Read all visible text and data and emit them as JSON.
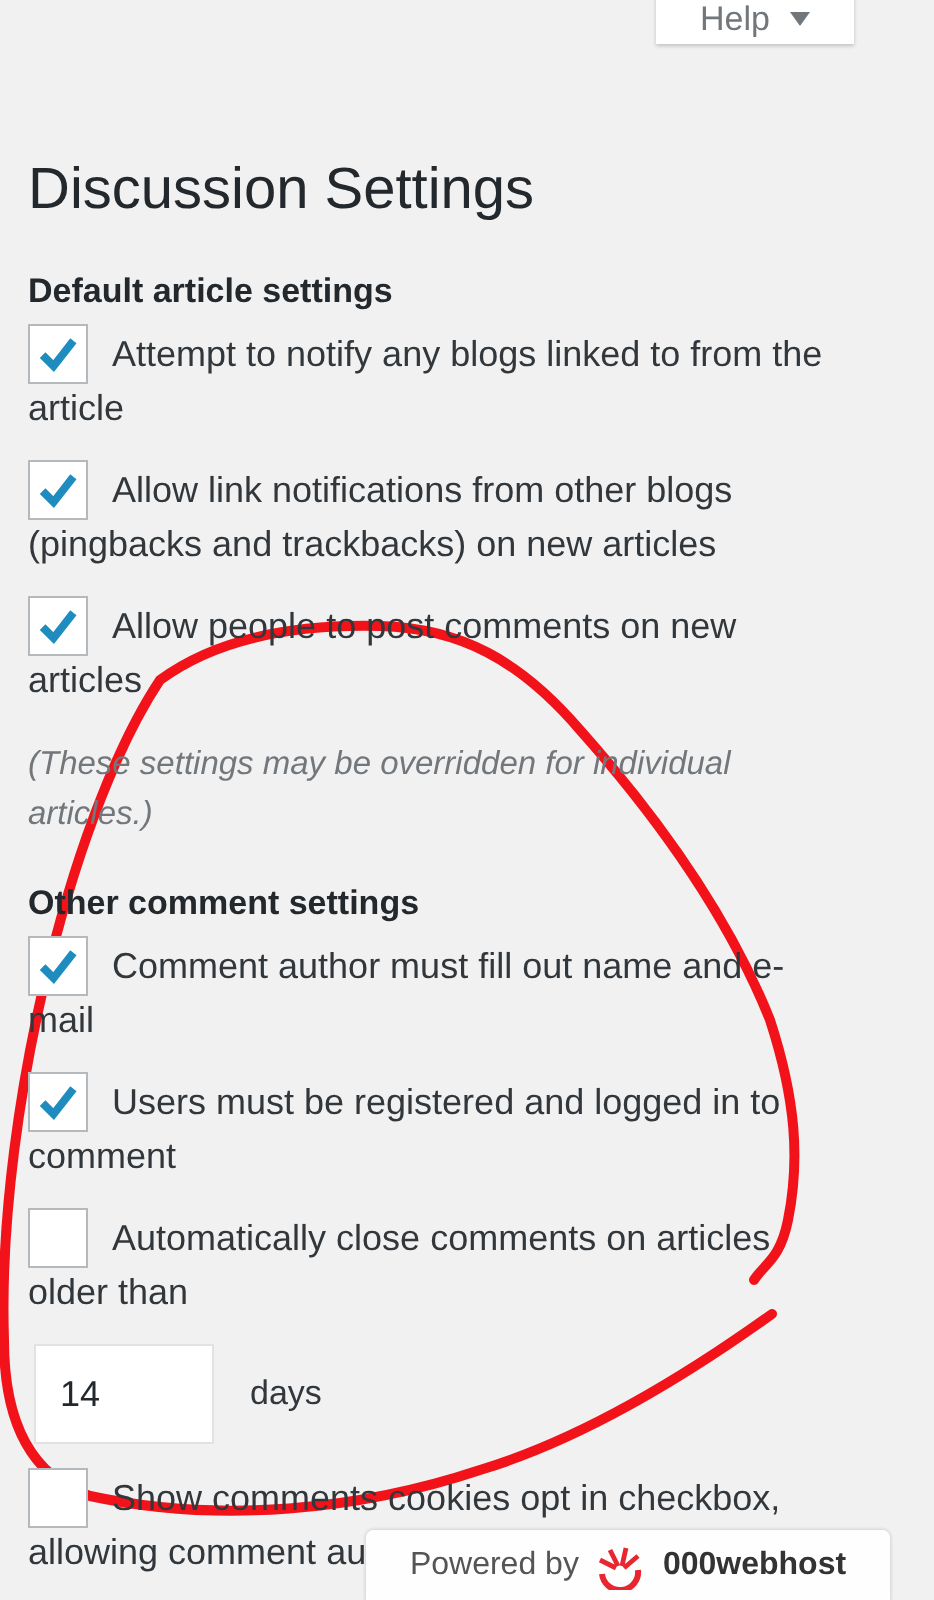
{
  "help_button": {
    "label": "Help"
  },
  "title": "Discussion Settings",
  "sections": [
    {
      "heading": "Default article settings",
      "items": [
        {
          "kind": "checkbox",
          "label": "Attempt to notify any blogs linked to from the article",
          "checked": true
        },
        {
          "kind": "checkbox",
          "label": "Allow link notifications from other blogs (pingbacks and trackbacks) on new articles",
          "checked": true
        },
        {
          "kind": "checkbox",
          "label": "Allow people to post comments on new articles",
          "checked": true
        },
        {
          "kind": "note",
          "text": "(These settings may be overridden for individual articles.)"
        }
      ]
    },
    {
      "heading": "Other comment settings",
      "items": [
        {
          "kind": "checkbox",
          "label": "Comment author must fill out name and e-mail",
          "checked": true
        },
        {
          "kind": "checkbox",
          "label": "Users must be registered and logged in to comment",
          "checked": true
        },
        {
          "kind": "checkbox",
          "label": "Automatically close comments on articles older than",
          "checked": false
        },
        {
          "kind": "number",
          "value": "14",
          "unit": "days"
        },
        {
          "kind": "checkbox",
          "label": "Show comments cookies opt in checkbox, allowing comment au",
          "checked": false
        }
      ]
    }
  ],
  "footer_badge": {
    "prefix": "Powered by",
    "brand": "000webhost"
  }
}
